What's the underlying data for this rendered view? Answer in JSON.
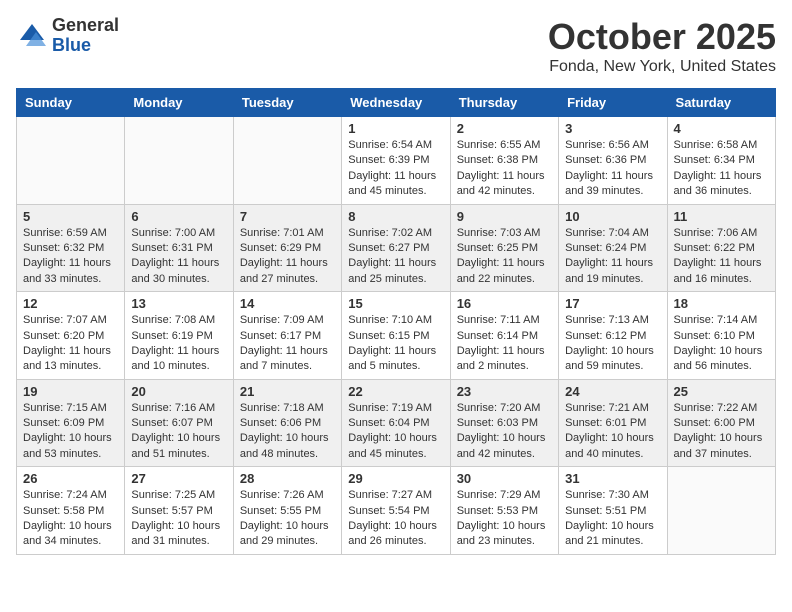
{
  "logo": {
    "general": "General",
    "blue": "Blue"
  },
  "title": "October 2025",
  "location": "Fonda, New York, United States",
  "days_of_week": [
    "Sunday",
    "Monday",
    "Tuesday",
    "Wednesday",
    "Thursday",
    "Friday",
    "Saturday"
  ],
  "weeks": [
    [
      {
        "day": "",
        "info": ""
      },
      {
        "day": "",
        "info": ""
      },
      {
        "day": "",
        "info": ""
      },
      {
        "day": "1",
        "info": "Sunrise: 6:54 AM\nSunset: 6:39 PM\nDaylight: 11 hours and 45 minutes."
      },
      {
        "day": "2",
        "info": "Sunrise: 6:55 AM\nSunset: 6:38 PM\nDaylight: 11 hours and 42 minutes."
      },
      {
        "day": "3",
        "info": "Sunrise: 6:56 AM\nSunset: 6:36 PM\nDaylight: 11 hours and 39 minutes."
      },
      {
        "day": "4",
        "info": "Sunrise: 6:58 AM\nSunset: 6:34 PM\nDaylight: 11 hours and 36 minutes."
      }
    ],
    [
      {
        "day": "5",
        "info": "Sunrise: 6:59 AM\nSunset: 6:32 PM\nDaylight: 11 hours and 33 minutes."
      },
      {
        "day": "6",
        "info": "Sunrise: 7:00 AM\nSunset: 6:31 PM\nDaylight: 11 hours and 30 minutes."
      },
      {
        "day": "7",
        "info": "Sunrise: 7:01 AM\nSunset: 6:29 PM\nDaylight: 11 hours and 27 minutes."
      },
      {
        "day": "8",
        "info": "Sunrise: 7:02 AM\nSunset: 6:27 PM\nDaylight: 11 hours and 25 minutes."
      },
      {
        "day": "9",
        "info": "Sunrise: 7:03 AM\nSunset: 6:25 PM\nDaylight: 11 hours and 22 minutes."
      },
      {
        "day": "10",
        "info": "Sunrise: 7:04 AM\nSunset: 6:24 PM\nDaylight: 11 hours and 19 minutes."
      },
      {
        "day": "11",
        "info": "Sunrise: 7:06 AM\nSunset: 6:22 PM\nDaylight: 11 hours and 16 minutes."
      }
    ],
    [
      {
        "day": "12",
        "info": "Sunrise: 7:07 AM\nSunset: 6:20 PM\nDaylight: 11 hours and 13 minutes."
      },
      {
        "day": "13",
        "info": "Sunrise: 7:08 AM\nSunset: 6:19 PM\nDaylight: 11 hours and 10 minutes."
      },
      {
        "day": "14",
        "info": "Sunrise: 7:09 AM\nSunset: 6:17 PM\nDaylight: 11 hours and 7 minutes."
      },
      {
        "day": "15",
        "info": "Sunrise: 7:10 AM\nSunset: 6:15 PM\nDaylight: 11 hours and 5 minutes."
      },
      {
        "day": "16",
        "info": "Sunrise: 7:11 AM\nSunset: 6:14 PM\nDaylight: 11 hours and 2 minutes."
      },
      {
        "day": "17",
        "info": "Sunrise: 7:13 AM\nSunset: 6:12 PM\nDaylight: 10 hours and 59 minutes."
      },
      {
        "day": "18",
        "info": "Sunrise: 7:14 AM\nSunset: 6:10 PM\nDaylight: 10 hours and 56 minutes."
      }
    ],
    [
      {
        "day": "19",
        "info": "Sunrise: 7:15 AM\nSunset: 6:09 PM\nDaylight: 10 hours and 53 minutes."
      },
      {
        "day": "20",
        "info": "Sunrise: 7:16 AM\nSunset: 6:07 PM\nDaylight: 10 hours and 51 minutes."
      },
      {
        "day": "21",
        "info": "Sunrise: 7:18 AM\nSunset: 6:06 PM\nDaylight: 10 hours and 48 minutes."
      },
      {
        "day": "22",
        "info": "Sunrise: 7:19 AM\nSunset: 6:04 PM\nDaylight: 10 hours and 45 minutes."
      },
      {
        "day": "23",
        "info": "Sunrise: 7:20 AM\nSunset: 6:03 PM\nDaylight: 10 hours and 42 minutes."
      },
      {
        "day": "24",
        "info": "Sunrise: 7:21 AM\nSunset: 6:01 PM\nDaylight: 10 hours and 40 minutes."
      },
      {
        "day": "25",
        "info": "Sunrise: 7:22 AM\nSunset: 6:00 PM\nDaylight: 10 hours and 37 minutes."
      }
    ],
    [
      {
        "day": "26",
        "info": "Sunrise: 7:24 AM\nSunset: 5:58 PM\nDaylight: 10 hours and 34 minutes."
      },
      {
        "day": "27",
        "info": "Sunrise: 7:25 AM\nSunset: 5:57 PM\nDaylight: 10 hours and 31 minutes."
      },
      {
        "day": "28",
        "info": "Sunrise: 7:26 AM\nSunset: 5:55 PM\nDaylight: 10 hours and 29 minutes."
      },
      {
        "day": "29",
        "info": "Sunrise: 7:27 AM\nSunset: 5:54 PM\nDaylight: 10 hours and 26 minutes."
      },
      {
        "day": "30",
        "info": "Sunrise: 7:29 AM\nSunset: 5:53 PM\nDaylight: 10 hours and 23 minutes."
      },
      {
        "day": "31",
        "info": "Sunrise: 7:30 AM\nSunset: 5:51 PM\nDaylight: 10 hours and 21 minutes."
      },
      {
        "day": "",
        "info": ""
      }
    ]
  ]
}
